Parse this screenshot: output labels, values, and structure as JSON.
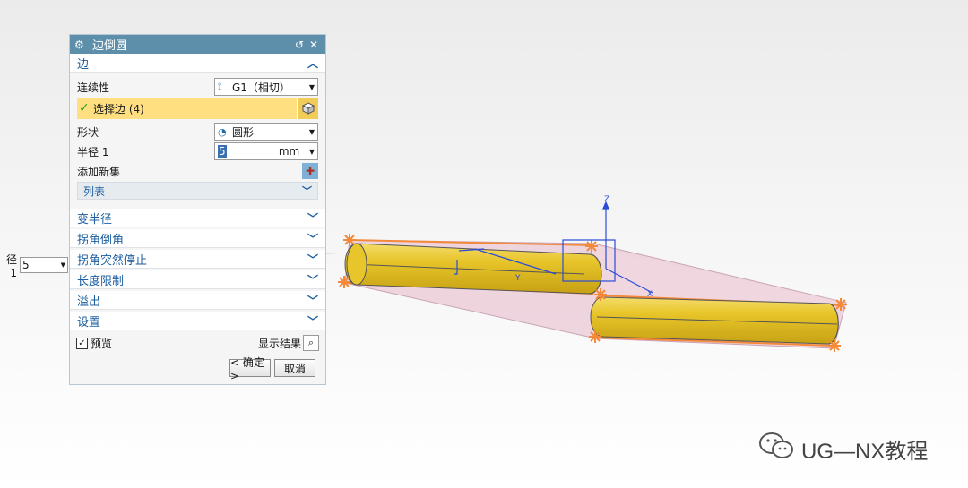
{
  "dialog": {
    "title": "边倒圆",
    "edge_section": {
      "title": "边",
      "continuity_label": "连续性",
      "continuity_value": "G1（相切）",
      "select_edge_label": "选择边 (4)",
      "shape_label": "形状",
      "shape_value": "圆形",
      "radius_label": "半径 1",
      "radius_value": "5",
      "radius_unit": "mm",
      "add_set_label": "添加新集",
      "list_label": "列表"
    },
    "collapsed_sections": [
      "变半径",
      "拐角倒角",
      "拐角突然停止",
      "长度限制",
      "溢出",
      "设置"
    ],
    "preview_label": "预览",
    "preview_checked": true,
    "show_result_label": "显示结果",
    "ok_label": "< 确定 >",
    "cancel_label": "取消"
  },
  "float_radius": {
    "label": "径 1",
    "value": "5"
  },
  "viewport": {
    "axis_labels": {
      "z": "Z",
      "y": "Y",
      "x": "X"
    }
  },
  "watermark": {
    "text": "UG—NX教程",
    "icon": "wechat-icon"
  },
  "colors": {
    "titlebar": "#5d8eaa",
    "section_text": "#1c5ea0",
    "select_highlight": "#ffdf80",
    "cylinder": "#e8c52a",
    "edge_marker": "#f5893a",
    "preview_fill": "#e9c8d4"
  }
}
